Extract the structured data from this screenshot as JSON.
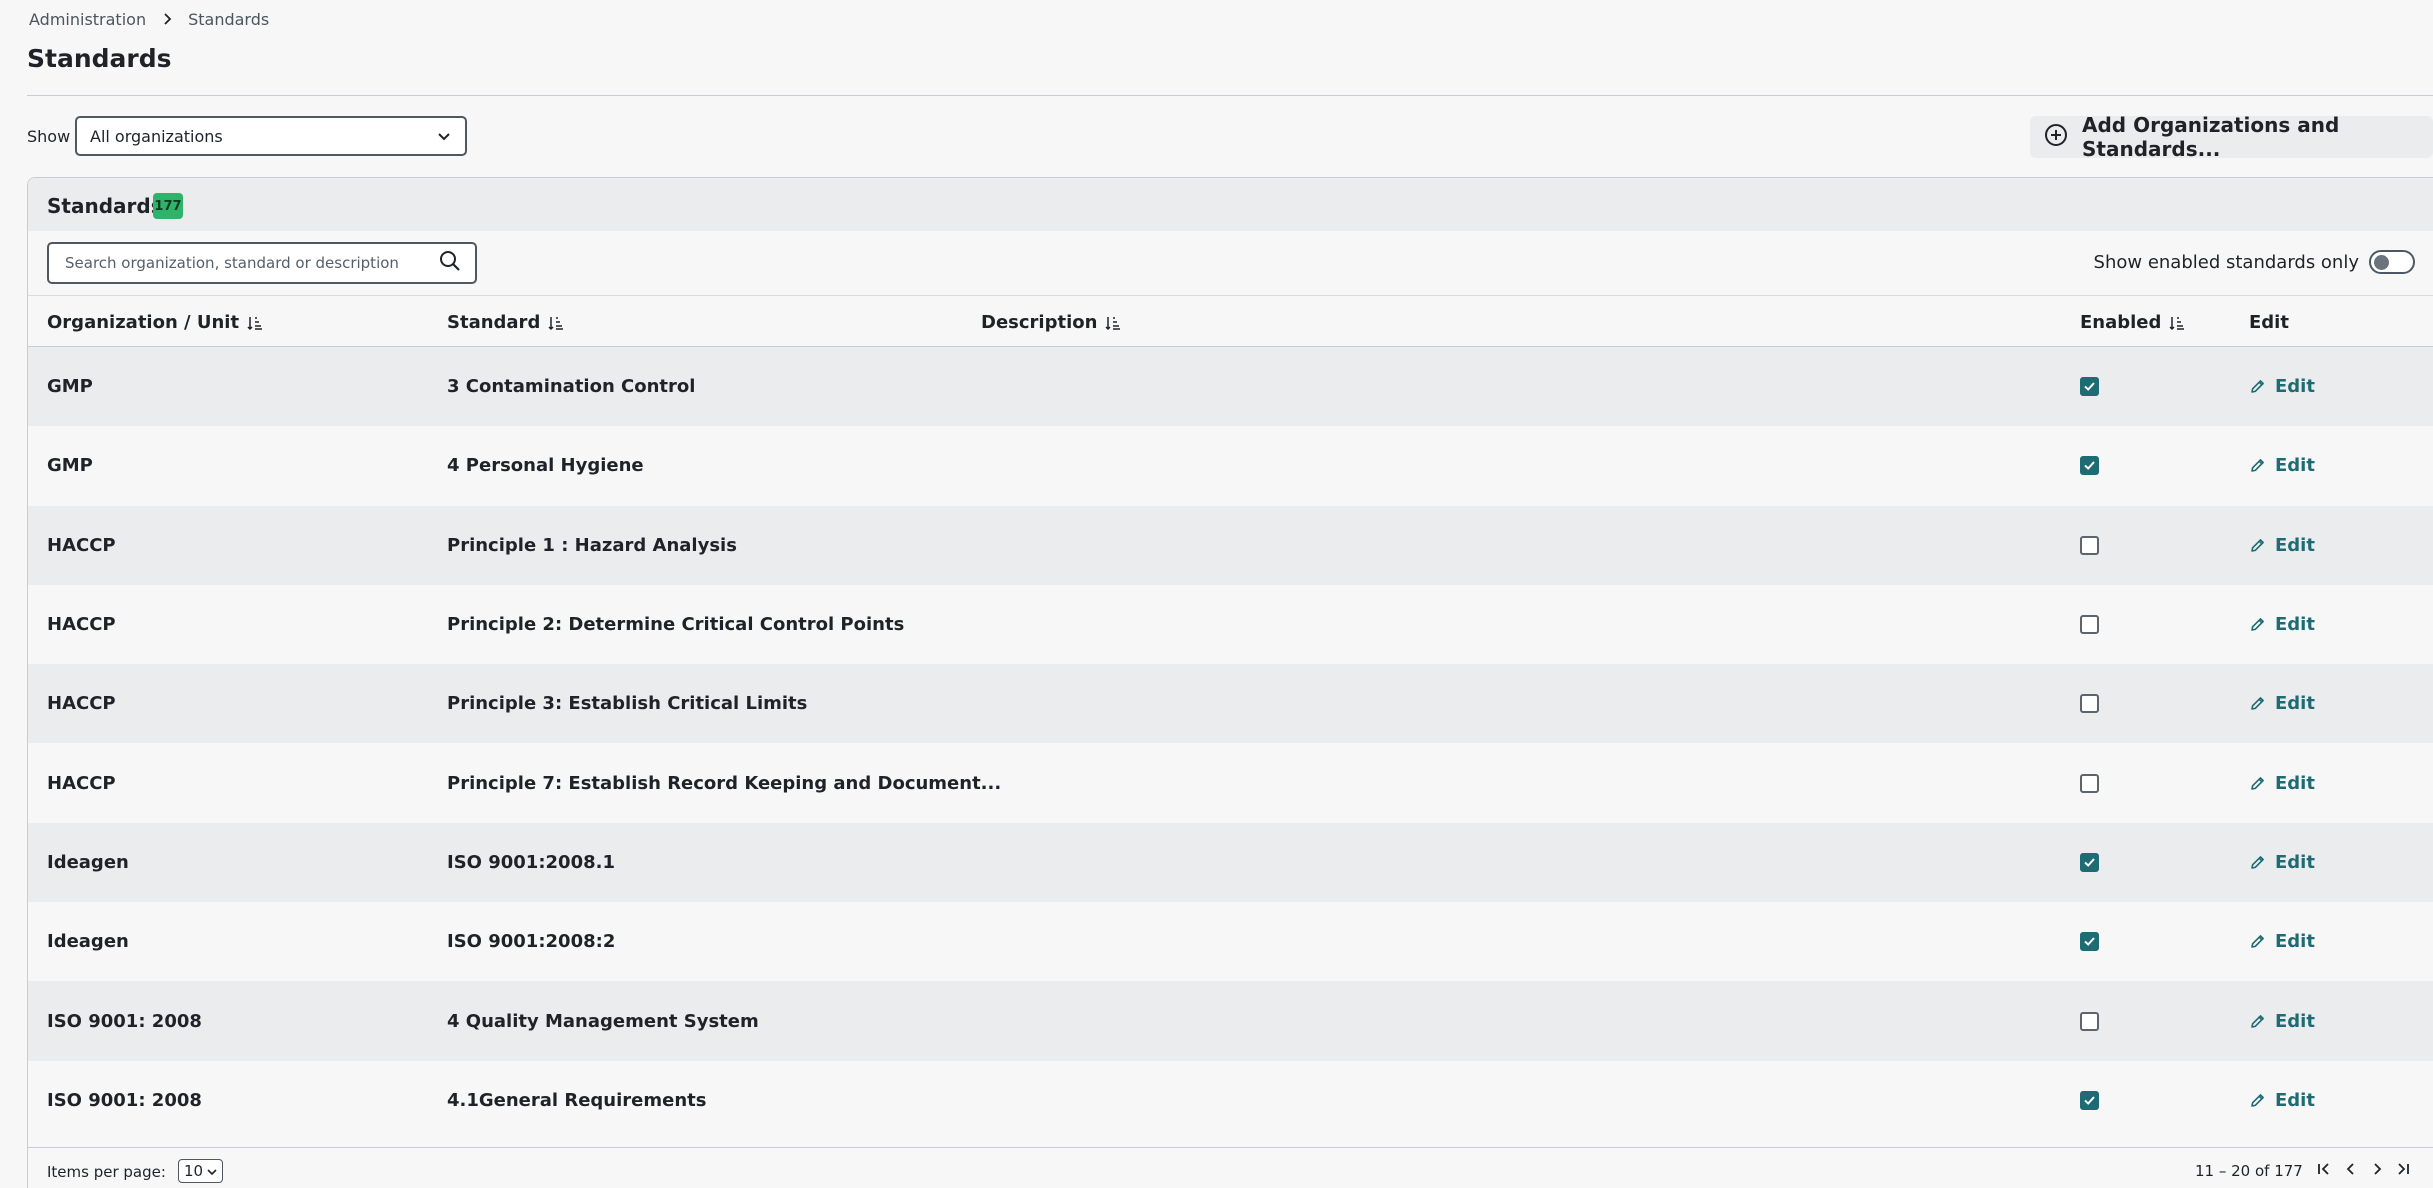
{
  "breadcrumb": {
    "items": [
      "Administration",
      "Standards"
    ]
  },
  "page": {
    "title": "Standards"
  },
  "filter": {
    "show_label": "Show",
    "selected": "All organizations"
  },
  "actions": {
    "add_label": "Add Organizations and Standards..."
  },
  "panel": {
    "title": "Standards",
    "count": "177",
    "search_placeholder": "Search organization, standard or description",
    "toggle_label": "Show enabled standards only",
    "toggle_on": false
  },
  "table": {
    "columns": {
      "org": "Organization / Unit",
      "standard": "Standard",
      "description": "Description",
      "enabled": "Enabled",
      "edit": "Edit"
    },
    "rows": [
      {
        "org": "GMP",
        "standard": "3 Contamination Control",
        "description": "",
        "enabled": true,
        "edit": "Edit"
      },
      {
        "org": "GMP",
        "standard": "4 Personal Hygiene",
        "description": "",
        "enabled": true,
        "edit": "Edit"
      },
      {
        "org": "HACCP",
        "standard": "Principle 1 : Hazard Analysis",
        "description": "",
        "enabled": false,
        "edit": "Edit"
      },
      {
        "org": "HACCP",
        "standard": "Principle 2: Determine Critical Control Points",
        "description": "",
        "enabled": false,
        "edit": "Edit"
      },
      {
        "org": "HACCP",
        "standard": "Principle 3: Establish Critical Limits",
        "description": "",
        "enabled": false,
        "edit": "Edit"
      },
      {
        "org": "HACCP",
        "standard": "Principle 7: Establish Record Keeping and Document...",
        "description": "",
        "enabled": false,
        "edit": "Edit"
      },
      {
        "org": "Ideagen",
        "standard": "ISO 9001:2008.1",
        "description": "",
        "enabled": true,
        "edit": "Edit"
      },
      {
        "org": "Ideagen",
        "standard": "ISO 9001:2008:2",
        "description": "",
        "enabled": true,
        "edit": "Edit"
      },
      {
        "org": "ISO 9001: 2008",
        "standard": "4 Quality Management System",
        "description": "",
        "enabled": false,
        "edit": "Edit"
      },
      {
        "org": "ISO 9001: 2008",
        "standard": "4.1General Requirements",
        "description": "",
        "enabled": true,
        "edit": "Edit"
      }
    ]
  },
  "pagination": {
    "items_per_page_label": "Items per page:",
    "items_per_page": "10",
    "range": "11 – 20 of 177"
  },
  "colors": {
    "accent": "#1e6b74",
    "badge": "#2fb36a",
    "row_shade": "#ebecee"
  }
}
